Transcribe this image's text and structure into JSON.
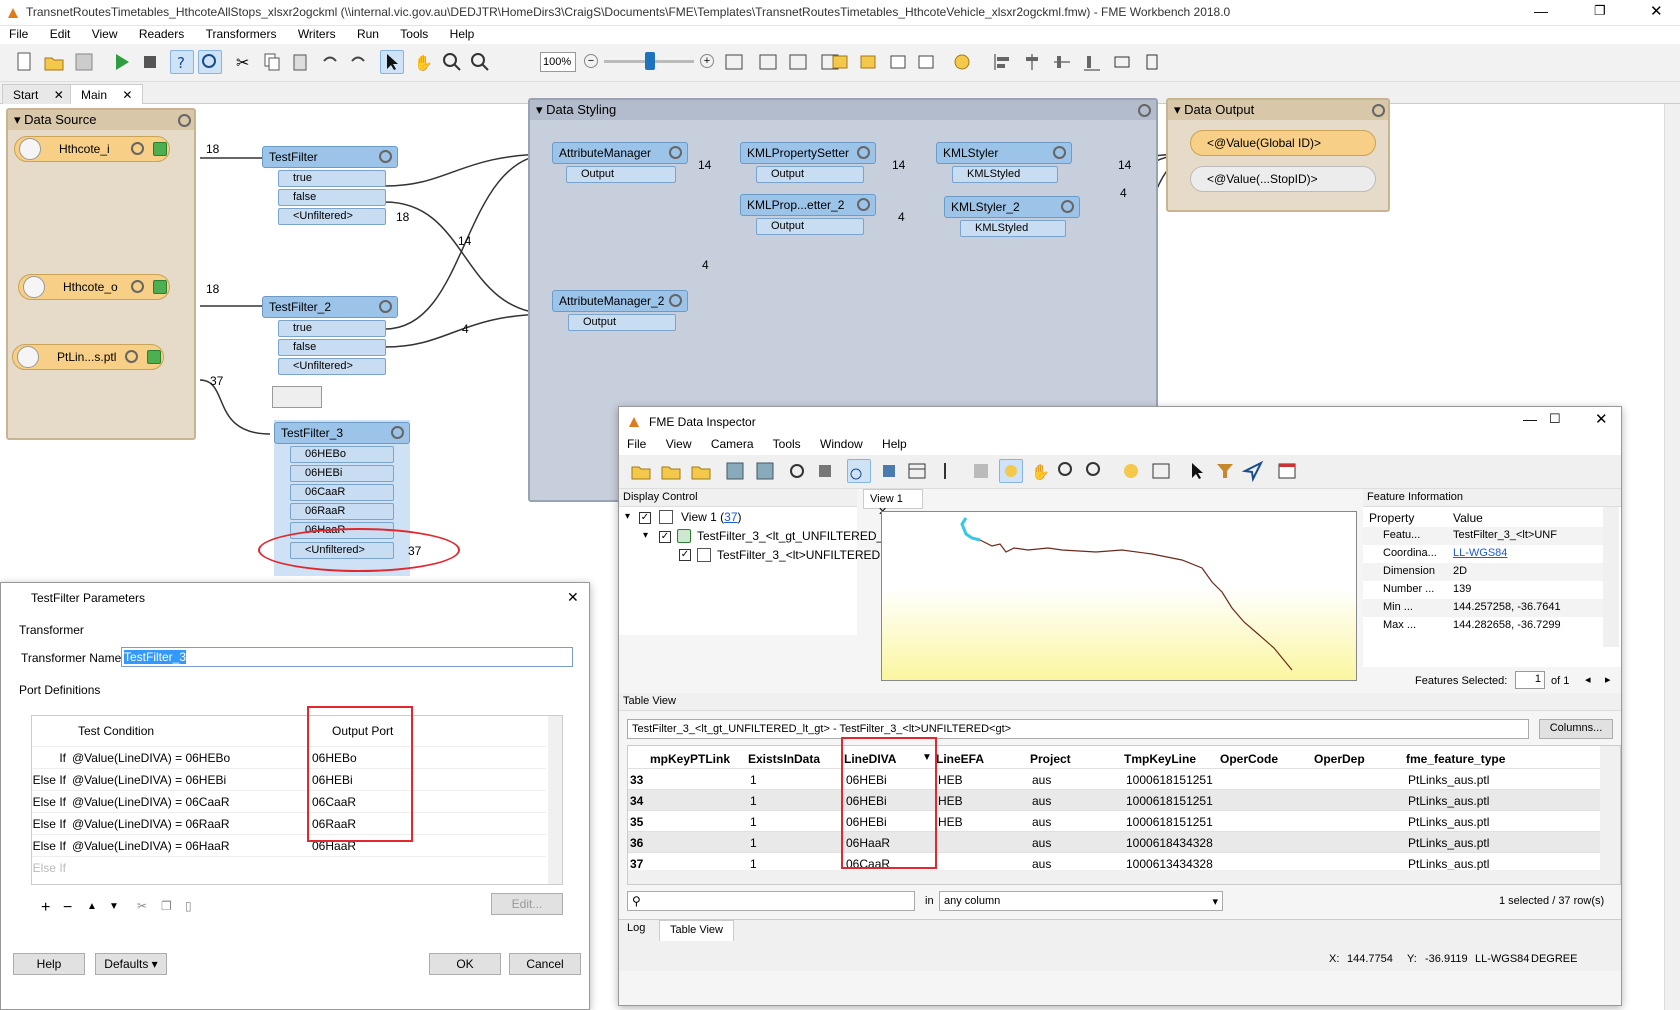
{
  "window": {
    "title": "TransnetRoutesTimetables_HthcoteAllStops_xlsxr2ogckml (\\\\internal.vic.gov.au\\DEDJTR\\HomeDirs3\\CraigS\\Documents\\FME\\Templates\\TransnetRoutesTimetables_HthcoteVehicle_xlsxr2ogckml.fmw) - FME Workbench 2018.0"
  },
  "menu": [
    "File",
    "Edit",
    "View",
    "Readers",
    "Transformers",
    "Writers",
    "Run",
    "Tools",
    "Help"
  ],
  "toolbar": {
    "zoom": "100%"
  },
  "tabs": [
    "Start",
    "Main"
  ],
  "bookmarks": {
    "source": "Data Source",
    "styling": "Data Styling",
    "output": "Data Output"
  },
  "readers": [
    {
      "label": "Hthcote_i",
      "count": "18"
    },
    {
      "label": "Hthcote_o",
      "count": "18"
    },
    {
      "label": "PtLin...s.ptl",
      "count": "37"
    }
  ],
  "transformers": {
    "tf1": {
      "name": "TestFilter",
      "ports": [
        "true",
        "false",
        "<Unfiltered>"
      ],
      "count": "18"
    },
    "tf2": {
      "name": "TestFilter_2",
      "ports": [
        "true",
        "false",
        "<Unfiltered>"
      ]
    },
    "tf3": {
      "name": "TestFilter_3",
      "ports": [
        "06HEBo",
        "06HEBi",
        "06CaaR",
        "06RaaR",
        "06HaaR",
        "<Unfiltered>"
      ],
      "count": "37"
    },
    "am1": {
      "name": "AttributeManager",
      "port": "Output",
      "count": "14"
    },
    "am2": {
      "name": "AttributeManager_2",
      "port": "Output"
    },
    "kp1": {
      "name": "KMLPropertySetter",
      "port": "Output",
      "count": "14"
    },
    "kp2": {
      "name": "KMLProp...etter_2",
      "port": "Output",
      "count": "4"
    },
    "ks1": {
      "name": "KMLStyler",
      "port": "KMLStyled",
      "count": "14"
    },
    "ks2": {
      "name": "KMLStyler_2",
      "port": "KMLStyled",
      "count": "4"
    },
    "w1": {
      "name": "<@Value(Global ID)>"
    },
    "w2": {
      "name": "<@Value(...StopID)>"
    }
  },
  "link_counts": {
    "a": "14",
    "b": "4",
    "c": "4"
  },
  "params": {
    "title": "TestFilter Parameters",
    "transformer_section": "Transformer",
    "name_label": "Transformer Name:",
    "name_value": "TestFilter_3",
    "port_section": "Port Definitions",
    "col_condition": "Test Condition",
    "col_port": "Output Port",
    "rows": [
      {
        "kw": "If",
        "cond": "@Value(LineDIVA) = 06HEBo",
        "port": "06HEBo"
      },
      {
        "kw": "Else If",
        "cond": "@Value(LineDIVA) = 06HEBi",
        "port": "06HEBi"
      },
      {
        "kw": "Else If",
        "cond": "@Value(LineDIVA) = 06CaaR",
        "port": "06CaaR"
      },
      {
        "kw": "Else If",
        "cond": "@Value(LineDIVA) = 06RaaR",
        "port": "06RaaR"
      },
      {
        "kw": "Else If",
        "cond": "@Value(LineDIVA) = 06HaaR",
        "port": "06HaaR"
      },
      {
        "kw": "Else If",
        "cond": "",
        "port": ""
      }
    ],
    "edit": "Edit...",
    "help": "Help",
    "defaults": "Defaults",
    "ok": "OK",
    "cancel": "Cancel"
  },
  "inspector": {
    "title": "FME Data Inspector",
    "menu": [
      "File",
      "View",
      "Camera",
      "Tools",
      "Window",
      "Help"
    ],
    "display_control": "Display Control",
    "view_tab": "View 1",
    "tree_root": "View 1 (",
    "tree_root_count": "37",
    "tree_root_close": ")",
    "tree_child1": "TestFilter_3_<lt_gt_UNFILTERED_",
    "tree_child2": "TestFilter_3_<lt>UNFILTERED",
    "feature_info": "Feature Information",
    "fi_cols": [
      "Property",
      "Value"
    ],
    "fi_rows": [
      {
        "k": "Featu...",
        "v": "TestFilter_3_<lt>UNF"
      },
      {
        "k": "Coordina...",
        "v": "LL-WGS84"
      },
      {
        "k": "Dimension",
        "v": "2D"
      },
      {
        "k": "Number ...",
        "v": "139"
      },
      {
        "k": "Min ...",
        "v": "144.257258, -36.7641"
      },
      {
        "k": "Max ...",
        "v": "144.282658, -36.7299"
      }
    ],
    "features_selected": "Features Selected:",
    "fs_value": "1",
    "fs_of": "of 1",
    "table_view": "Table View",
    "dataset": "TestFilter_3_<lt_gt_UNFILTERED_lt_gt> - TestFilter_3_<lt>UNFILTERED<gt>",
    "columns_btn": "Columns...",
    "cols": [
      "mpKeyPTLink",
      "ExistsInData",
      "LineDIVA",
      "LineEFA",
      "Project",
      "TmpKeyLine",
      "OperCode",
      "OperDep",
      "fme_feature_type"
    ],
    "rows": [
      {
        "n": "33",
        "exists": "1",
        "diva": "06HEBi",
        "efa": "HEB",
        "proj": "aus",
        "key": "1000618151251",
        "type": "PtLinks_aus.ptl"
      },
      {
        "n": "34",
        "exists": "1",
        "diva": "06HEBi",
        "efa": "HEB",
        "proj": "aus",
        "key": "1000618151251",
        "type": "PtLinks_aus.ptl"
      },
      {
        "n": "35",
        "exists": "1",
        "diva": "06HEBi",
        "efa": "HEB",
        "proj": "aus",
        "key": "1000618151251",
        "type": "PtLinks_aus.ptl"
      },
      {
        "n": "36",
        "exists": "1",
        "diva": "06HaaR",
        "efa": "",
        "proj": "aus",
        "key": "1000618434328",
        "type": "PtLinks_aus.ptl"
      },
      {
        "n": "37",
        "exists": "1",
        "diva": "06CaaR",
        "efa": "",
        "proj": "aus",
        "key": "1000613434328",
        "type": "PtLinks_aus.ptl"
      }
    ],
    "search_in": "in",
    "search_col": "any column",
    "status": "1 selected / 37 row(s)",
    "bottom_tabs": [
      "Log",
      "Table View"
    ],
    "coord_x_lbl": "X:",
    "coord_x": "144.7754",
    "coord_y_lbl": "Y:",
    "coord_y": "-36.9119",
    "coord_sys": "LL-WGS84",
    "coord_unit": "DEGREE"
  }
}
